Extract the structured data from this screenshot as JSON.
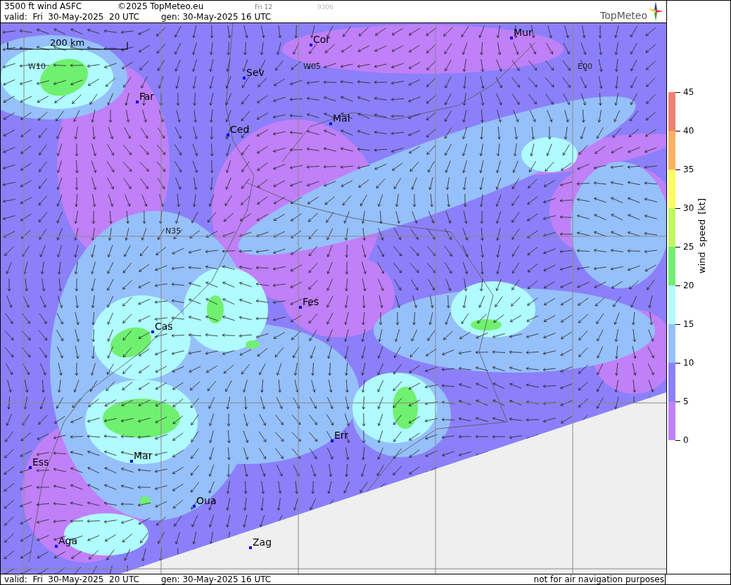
{
  "header": {
    "product": "3500 ft wind ASFC",
    "copyright": "©2025 TopMeteo.eu",
    "frame": "Fri 12",
    "code": "9306",
    "valid": "valid:  Fri  30-May-2025  20 UTC",
    "generated": "gen: 30-May-2025 16 UTC",
    "logo": "TopMeteo"
  },
  "map": {
    "scale": "200 km",
    "grid_labels": [
      "W10",
      "W05",
      "E00",
      "N35"
    ],
    "cities": [
      {
        "name": "Cor"
      },
      {
        "name": "Mur"
      },
      {
        "name": "Sev"
      },
      {
        "name": "Far"
      },
      {
        "name": "Ced"
      },
      {
        "name": "Mal"
      },
      {
        "name": "Fes"
      },
      {
        "name": "Cas"
      },
      {
        "name": "Err"
      },
      {
        "name": "Mar"
      },
      {
        "name": "Ess"
      },
      {
        "name": "Oua"
      },
      {
        "name": "Aga"
      },
      {
        "name": "Zag"
      }
    ]
  },
  "legend": {
    "title": "wind speed [kt]",
    "levels": [
      {
        "label": "45",
        "color": "#f08070"
      },
      {
        "label": "40",
        "color": "#fdb060"
      },
      {
        "label": "35",
        "color": "#fdfd60"
      },
      {
        "label": "30",
        "color": "#c0f860"
      },
      {
        "label": "25",
        "color": "#70f070"
      },
      {
        "label": "20",
        "color": "#b0fbfd"
      },
      {
        "label": "15",
        "color": "#96c0fa"
      },
      {
        "label": "10",
        "color": "#8b80f9"
      },
      {
        "label": "5",
        "color": "#c080f8"
      }
    ],
    "bottom_label": "0"
  },
  "footer": {
    "valid": "valid:  Fri  30-May-2025  20 UTC",
    "generated": "gen: 30-May-2025 16 UTC",
    "disclaimer": "not for air navigation purposes"
  }
}
